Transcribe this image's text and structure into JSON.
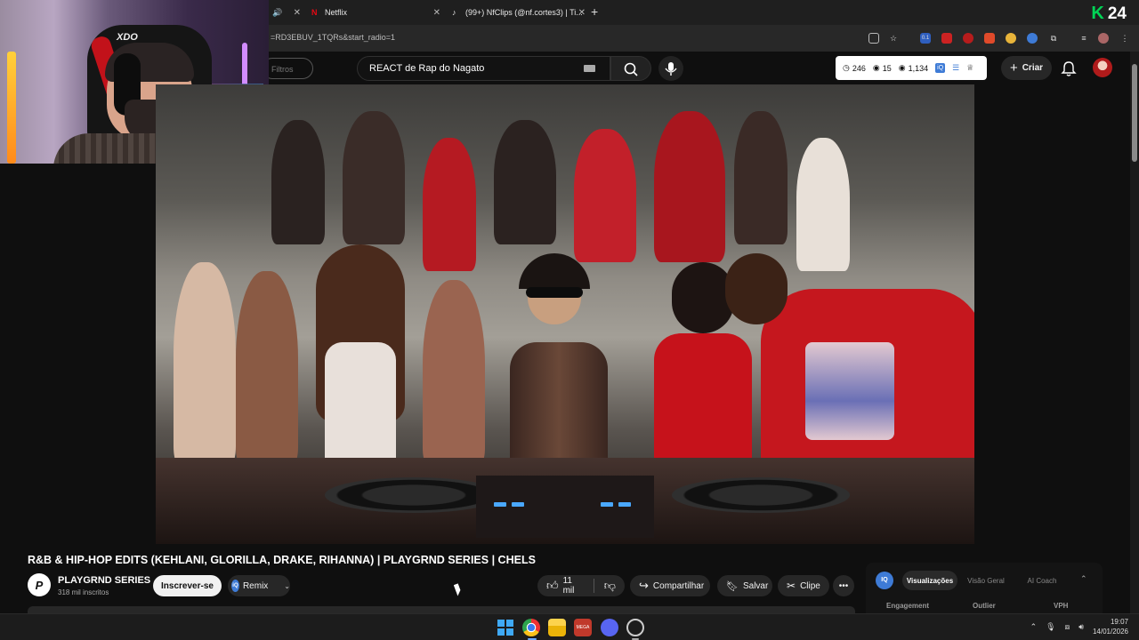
{
  "browser": {
    "tabs": [
      {
        "label": "",
        "icon": "speaker-icon"
      },
      {
        "label": "Netflix",
        "icon": "netflix-icon"
      },
      {
        "label": "(99+) NfClips (@nf.cortes3) | Ti...",
        "icon": "tiktok-icon"
      }
    ],
    "url": "=RD3EBUV_1TQRs&start_radio=1",
    "overlay_badge": "24"
  },
  "youtube": {
    "filters_label": "Filtros",
    "search_value": "REACT de Rap do Nagato",
    "stats": {
      "videos": "246",
      "views_a": "15",
      "views_b": "1,134"
    },
    "create_label": "Criar"
  },
  "video": {
    "title": "R&B & HIP-HOP EDITS (KEHLANI, GLORILLA, DRAKE, RIHANNA) | PLAYGRND SERIES | CHELS",
    "channel": {
      "name": "PLAYGRND SERIES",
      "subscribers": "318 mil inscritos"
    },
    "subscribe_label": "Inscrever-se",
    "remix_label": "Remix",
    "actions": {
      "likes": "11 mil",
      "share": "Compartilhar",
      "save": "Salvar",
      "clip": "Clipe"
    }
  },
  "iq_panel": {
    "logo": "IQ",
    "tabs": [
      "Visualizações",
      "Visão Geral",
      "AI Coach"
    ],
    "columns": [
      "Engagement",
      "Outlier",
      "VPH"
    ]
  },
  "webcam": {
    "logo_text": "XDO"
  },
  "taskbar": {
    "time": "19:07",
    "date": "14/01/2026",
    "app_label": "MEGA"
  },
  "colors": {
    "brand_red": "#c5171e",
    "accent_blue": "#3e7bd6",
    "k24_green": "#00d455"
  }
}
